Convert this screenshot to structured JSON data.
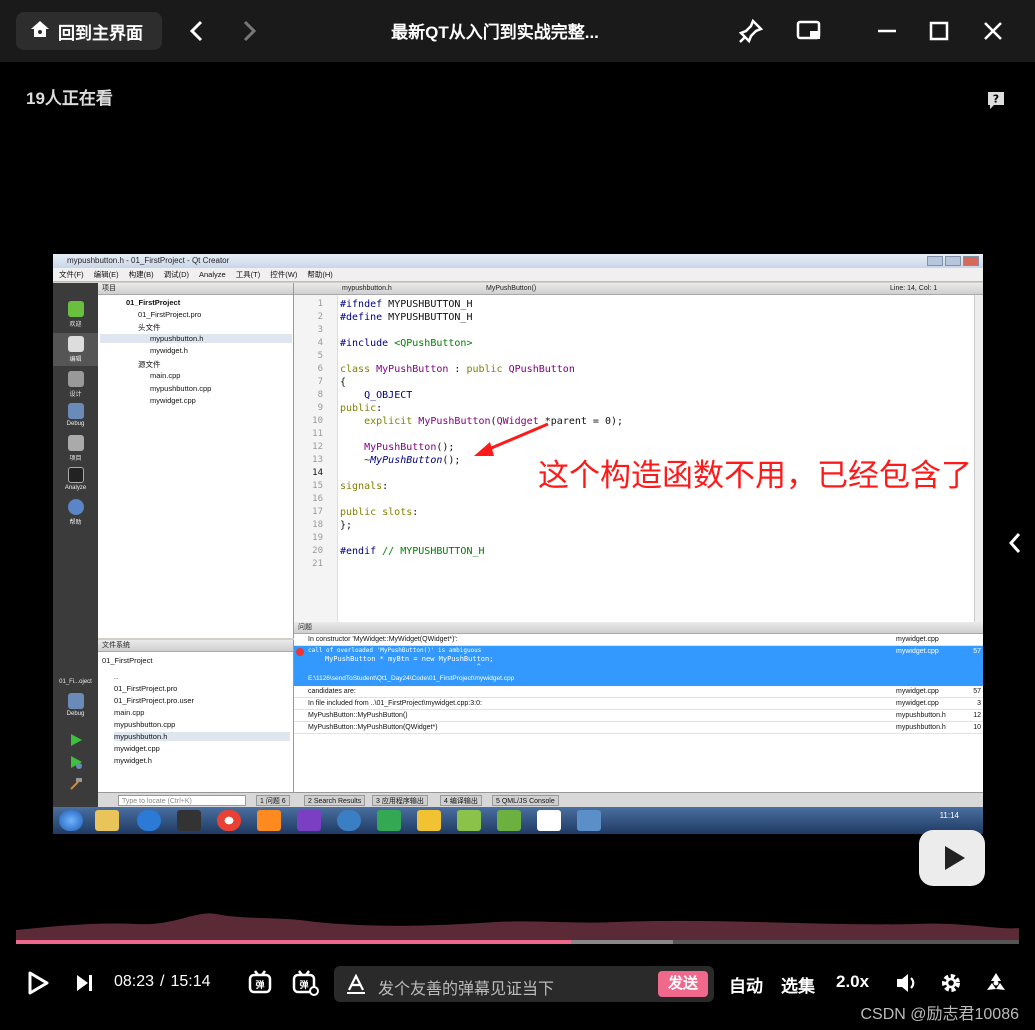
{
  "topbar": {
    "home_label": "回到主界面",
    "title": "最新QT从入门到实战完整...",
    "icons": [
      "home-icon",
      "back-icon",
      "forward-icon",
      "pin-icon",
      "pip-icon",
      "minimize-icon",
      "maximize-icon",
      "close-icon"
    ]
  },
  "viewers": "19人正在看",
  "video": {
    "qt_title": "mypushbutton.h - 01_FirstProject - Qt Creator",
    "menu": [
      "文件(F)",
      "编辑(E)",
      "构建(B)",
      "调试(D)",
      "Analyze",
      "工具(T)",
      "控件(W)",
      "帮助(H)"
    ],
    "side_buttons": [
      "欢迎",
      "编辑",
      "设计",
      "Debug",
      "项目",
      "Analyze",
      "帮助"
    ],
    "side_project_label": "01_Fi...oject",
    "side_debug_label": "Debug",
    "project_panel_title": "项目",
    "project_tree": [
      {
        "label": "01_FirstProject",
        "bold": true
      },
      {
        "label": "01_FirstProject.pro"
      },
      {
        "label": "头文件"
      },
      {
        "label": "mypushbutton.h",
        "selected": true
      },
      {
        "label": "mywidget.h"
      },
      {
        "label": "源文件"
      },
      {
        "label": "main.cpp"
      },
      {
        "label": "mypushbutton.cpp"
      },
      {
        "label": "mywidget.cpp"
      }
    ],
    "fs_panel_title": "文件系统",
    "fs_root": "01_FirstProject",
    "fs_items": [
      "..",
      "01_FirstProject.pro",
      "01_FirstProject.pro.user",
      "main.cpp",
      "mypushbutton.cpp",
      "mypushbutton.h",
      "mywidget.cpp",
      "mywidget.h"
    ],
    "editor_tab": "mypushbutton.h",
    "editor_symbol": "MyPushButton()",
    "editor_pos": "Line: 14, Col: 1",
    "line_numbers": [
      "1",
      "2",
      "3",
      "4",
      "5",
      "6",
      "7",
      "8",
      "9",
      "10",
      "11",
      "12",
      "13",
      "14",
      "15",
      "16",
      "17",
      "18",
      "19",
      "20",
      "21"
    ],
    "issues_title": "问题",
    "issues": [
      {
        "text": "In constructor 'MyWidget::MyWidget(QWidget*)':",
        "file": "mywidget.cpp",
        "line": ""
      },
      {
        "text": "candidates are:",
        "file": "mywidget.cpp",
        "line": "57"
      },
      {
        "text": "In file included from ..\\01_FirstProject\\mywidget.cpp:3:0:",
        "file": "mywidget.cpp",
        "line": "3"
      },
      {
        "text": "MyPushButton::MyPushButton()",
        "file": "mypushbutton.h",
        "line": "12"
      },
      {
        "text": "MyPushButton::MyPushButton(QWidget*)",
        "file": "mypushbutton.h",
        "line": "10"
      }
    ],
    "selected_issue": {
      "line1": "call of overloaded 'MyPushButton()' is ambiguous",
      "line2": "    MyPushButton * myBtn = new MyPushButton;",
      "line3": "                                        ^",
      "line4": "E:\\1126\\sendToStudent\\Qt1_Day24\\Code\\01_FirstProject\\mywidget.cpp",
      "file": "mywidget.cpp",
      "line": "57"
    },
    "statusbar": {
      "locate_placeholder": "Type to locate (Ctrl+K)",
      "tabs": [
        "1 问题 6",
        "2 Search Results",
        "3 应用程序输出",
        "4 编译输出",
        "5 QML/JS Console"
      ]
    },
    "tray_time": "11:14"
  },
  "annotation": "这个构造函数不用，已经包含了",
  "player": {
    "current_time": "08:23",
    "total_time": "15:14",
    "progress": 0.553,
    "buffered": 0.655,
    "danmaku_placeholder": "发个友善的弹幕见证当下",
    "send_label": "发送",
    "auto_label": "自动",
    "episodes_label": "选集",
    "speed_label": "2.0x"
  },
  "watermark": "CSDN @励志君10086"
}
